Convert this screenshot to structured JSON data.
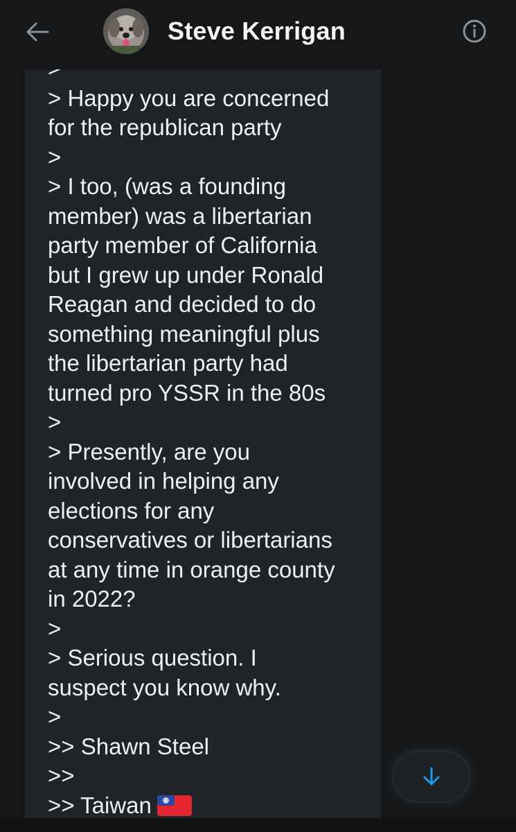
{
  "header": {
    "title": "Steve Kerrigan",
    "back_icon": "arrow-left-icon",
    "info_icon": "info-circle-icon",
    "avatar_icon": "profile-photo-dog"
  },
  "message": {
    "lines": [
      ">",
      "> Happy you are concerned",
      "for the republican party",
      ">",
      "> I too, (was a founding",
      "member) was a libertarian",
      "party member of California",
      "but I grew up under Ronald",
      "Reagan and decided to do",
      "something meaningful plus",
      "the libertarian party had",
      "turned pro YSSR in the 80s",
      ">",
      "> Presently, are you",
      "involved in helping any",
      "elections for any",
      "conservatives or libertarians",
      "at any time in orange county",
      "in 2022?",
      ">",
      "> Serious question. I",
      "suspect you know why.",
      ">",
      ">> Shawn Steel",
      ">>",
      ">> Taiwan"
    ],
    "flag_icon": "taiwan-flag-icon"
  },
  "scroll_button": {
    "icon": "arrow-down-icon"
  },
  "colors": {
    "background": "#151718",
    "bubble": "#212426",
    "text": "#eef0f1",
    "accent": "#1d9bf0",
    "muted_icon": "#8b9399"
  }
}
